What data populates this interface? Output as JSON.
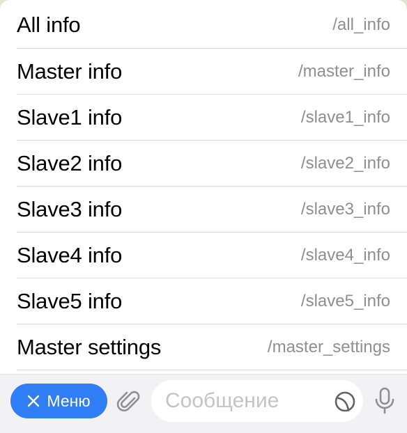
{
  "menu": {
    "items": [
      {
        "label": "All info",
        "command": "/all_info"
      },
      {
        "label": "Master info",
        "command": "/master_info"
      },
      {
        "label": "Slave1 info",
        "command": "/slave1_info"
      },
      {
        "label": "Slave2 info",
        "command": "/slave2_info"
      },
      {
        "label": "Slave3 info",
        "command": "/slave3_info"
      },
      {
        "label": "Slave4 info",
        "command": "/slave4_info"
      },
      {
        "label": "Slave5 info",
        "command": "/slave5_info"
      },
      {
        "label": "Master settings",
        "command": "/master_settings"
      }
    ]
  },
  "composer": {
    "menu_button_label": "Меню",
    "message_placeholder": "Сообщение",
    "icons": {
      "close": "close-icon",
      "attach": "paperclip-icon",
      "sticker": "sticker-icon",
      "mic": "microphone-icon"
    }
  },
  "colors": {
    "accent": "#2f7ef5",
    "command_text": "#8e8e93",
    "divider": "#dcdcdc",
    "icon_gray": "#8e8e93"
  }
}
